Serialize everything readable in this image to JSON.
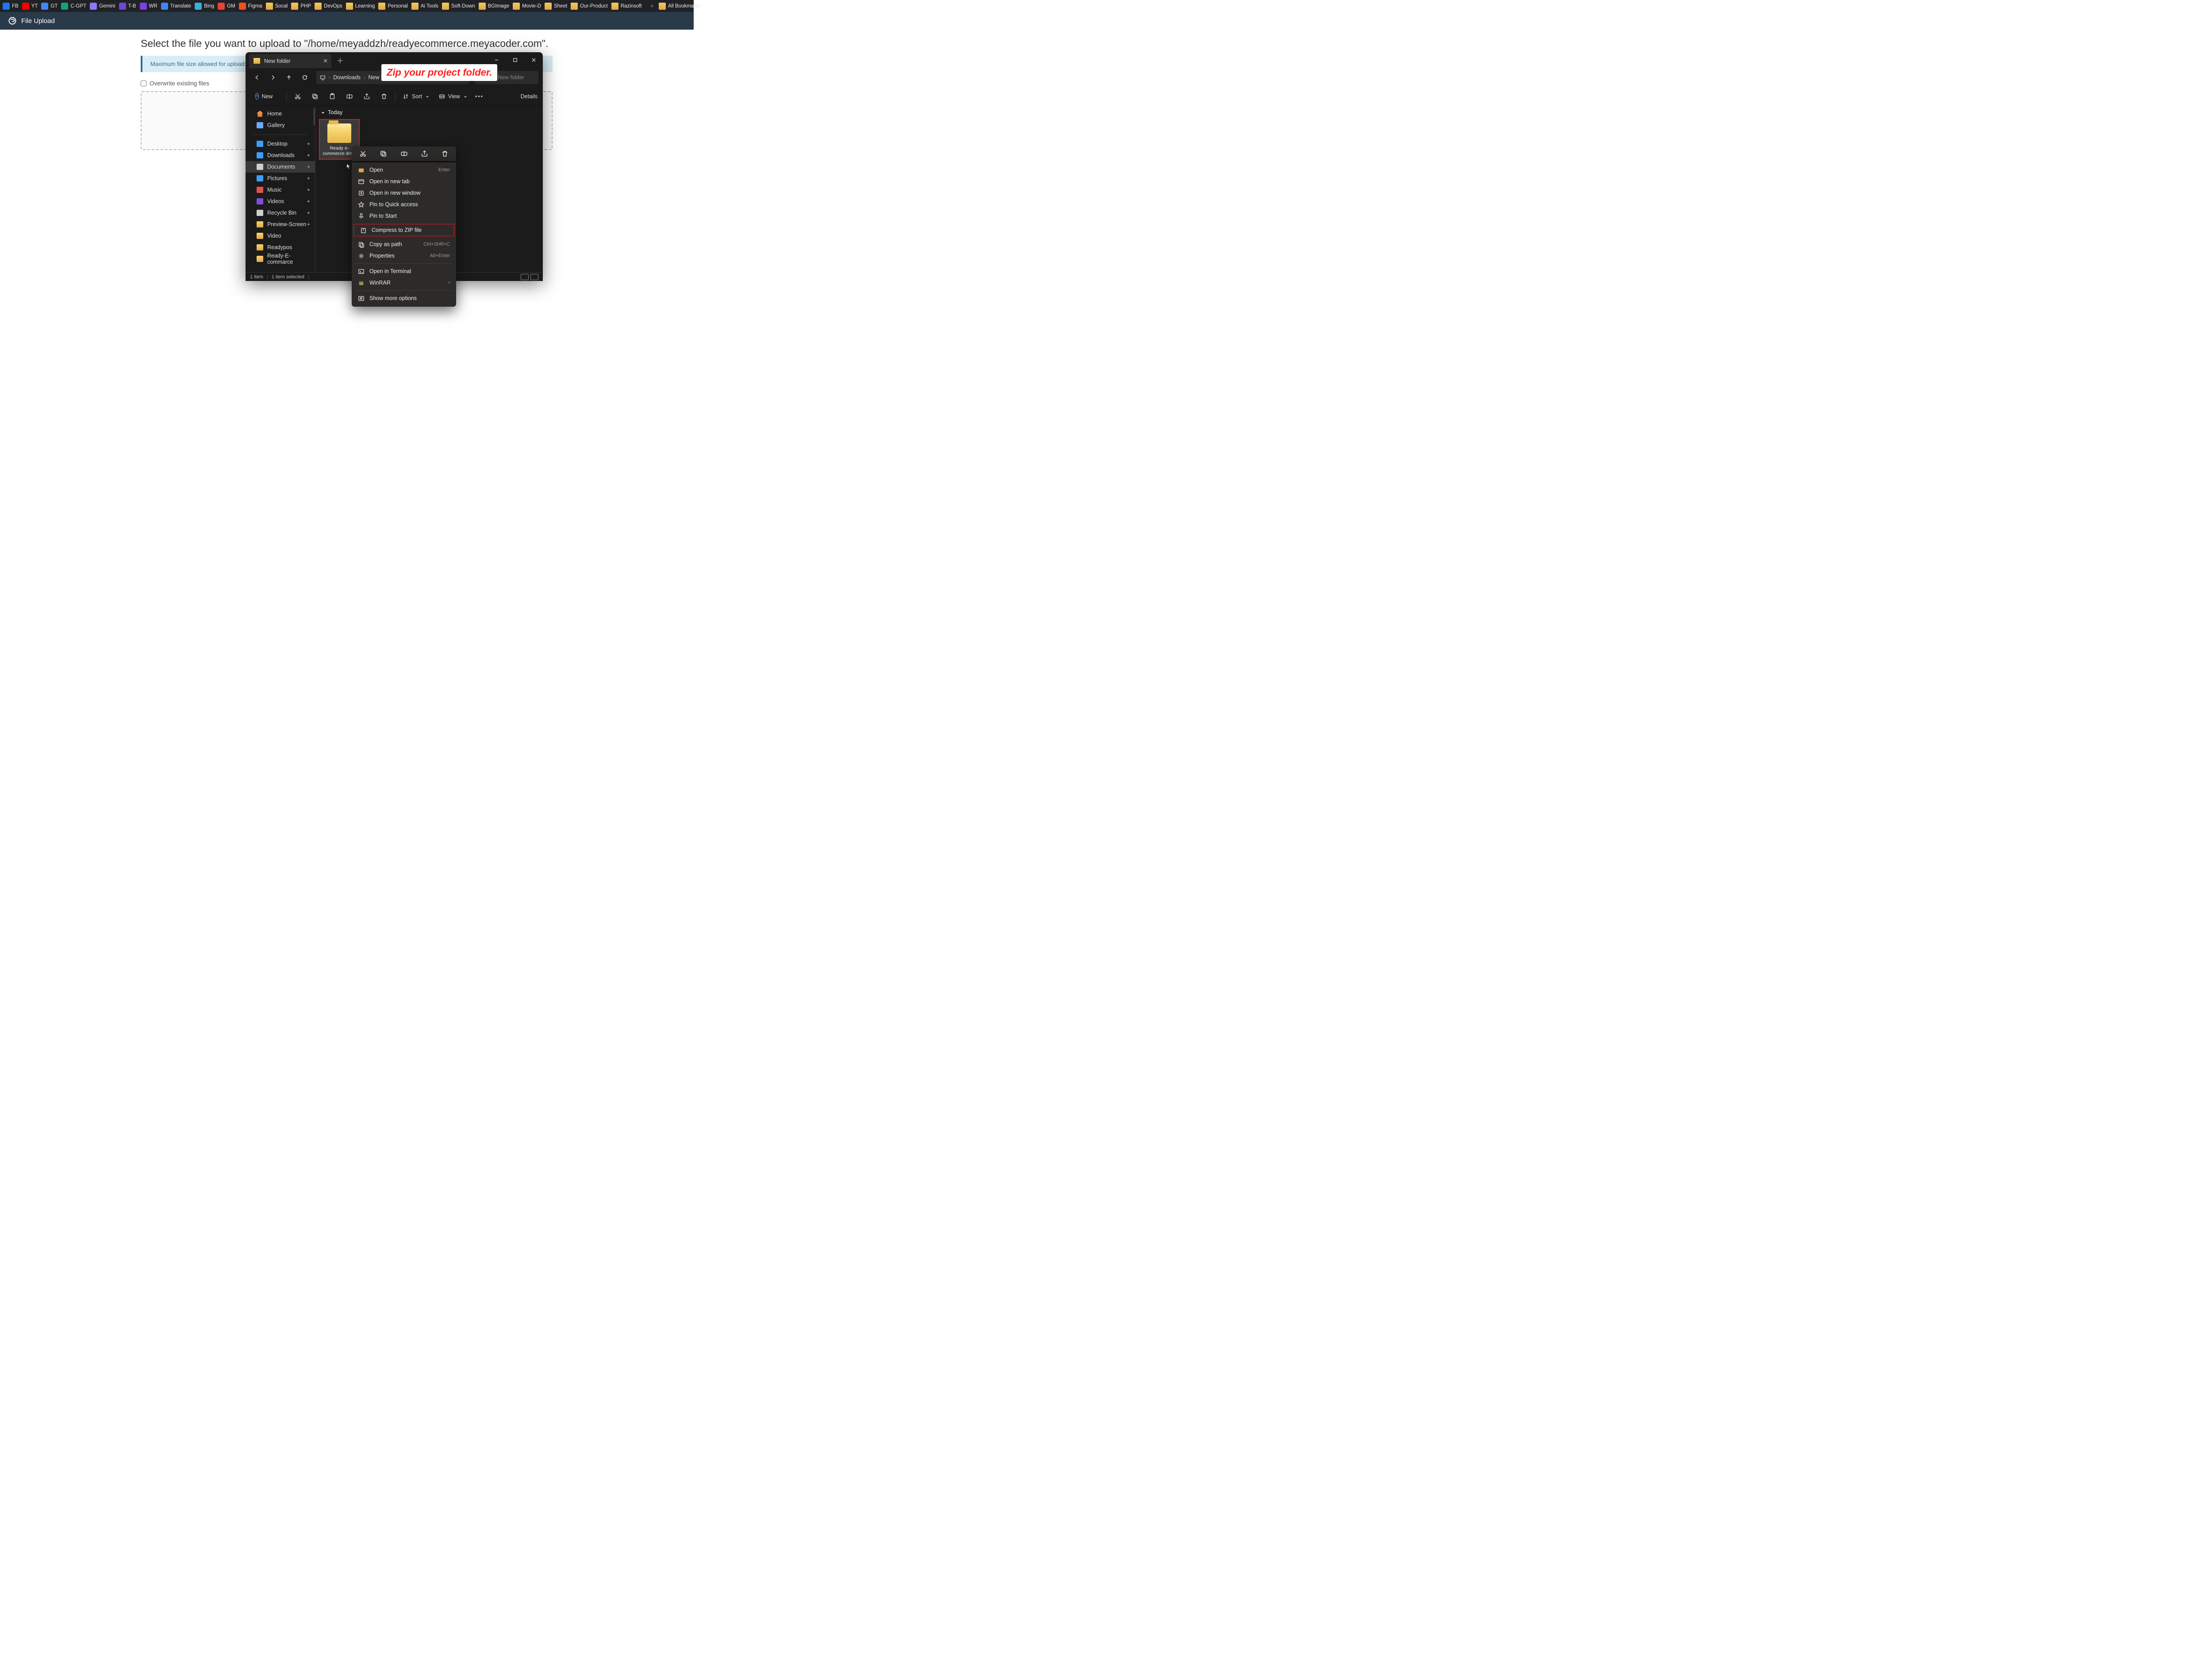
{
  "bookmarks": {
    "items": [
      {
        "label": "FB",
        "color": "#1877F2"
      },
      {
        "label": "YT",
        "color": "#FF0000"
      },
      {
        "label": "GT",
        "color": "#4285F4"
      },
      {
        "label": "C-GPT",
        "color": "#10A37F"
      },
      {
        "label": "Gemini",
        "color": "#8E75F9"
      },
      {
        "label": "T-B",
        "color": "#6E47D6"
      },
      {
        "label": "WR",
        "color": "#7B3FE4"
      },
      {
        "label": "Translate",
        "color": "#4285F4"
      },
      {
        "label": "Bing",
        "color": "#3AAEDC"
      },
      {
        "label": "GM",
        "color": "#EA4335"
      },
      {
        "label": "Figma",
        "color": "#F24E1E"
      }
    ],
    "folders": [
      "Socal",
      "PHP",
      "DevOps",
      "Learning",
      "Personal",
      "Ai Tools",
      "Soft-Down",
      "BGImage",
      "Movie-D",
      "Sheet",
      "Our-Product",
      "Razinsoft"
    ],
    "more": "»",
    "all": "All Bookmarks"
  },
  "cpanel": {
    "title": "File Upload"
  },
  "page": {
    "heading": "Select the file you want to upload to \"/home/meyaddzh/readyecommerce.meyacoder.com\".",
    "maxsize": "Maximum file size allowed for upload: ∞",
    "overwrite": "Overwrite existing files"
  },
  "explorer": {
    "tab": "New folder",
    "breadcrumb": [
      "Downloads",
      "New folder"
    ],
    "search": "Search New folder",
    "toolbar": {
      "new": "New",
      "sort": "Sort",
      "view": "View",
      "details": "Details"
    },
    "sidebar_top": [
      {
        "label": "Home",
        "type": "home"
      },
      {
        "label": "Gallery",
        "type": "gallery"
      }
    ],
    "sidebar": [
      {
        "label": "Desktop",
        "color": "#3aa0ff",
        "pin": true
      },
      {
        "label": "Downloads",
        "color": "#3aa0ff",
        "pin": true
      },
      {
        "label": "Documents",
        "color": "#cfcfcf",
        "pin": true,
        "sel": true
      },
      {
        "label": "Pictures",
        "color": "#3aa0ff",
        "pin": true
      },
      {
        "label": "Music",
        "color": "#e1524c",
        "pin": true
      },
      {
        "label": "Videos",
        "color": "#7b52d6",
        "pin": true
      },
      {
        "label": "Recycle Bin",
        "color": "#cfcfcf",
        "pin": true
      },
      {
        "label": "Preview-Screen",
        "color": "#e0a93f",
        "pin": true
      },
      {
        "label": "Video",
        "color": "#e0a93f",
        "pin": false
      },
      {
        "label": "Readypos",
        "color": "#e0a93f",
        "pin": false
      },
      {
        "label": "Ready-E-commarce",
        "color": "#e0a93f",
        "pin": false
      }
    ],
    "group": "Today",
    "folder_name": "Ready e-commerce dmin",
    "status": {
      "items": "1 item",
      "selected": "1 item selected"
    }
  },
  "callout": "Zip your project folder.",
  "context": {
    "items": [
      {
        "label": "Open",
        "shortcut": "Enter",
        "icon": "open"
      },
      {
        "label": "Open in new tab",
        "icon": "newtab"
      },
      {
        "label": "Open in new window",
        "icon": "newwin"
      },
      {
        "label": "Pin to Quick access",
        "icon": "pin"
      },
      {
        "label": "Pin to Start",
        "icon": "pin2"
      },
      {
        "label": "Compress to ZIP file",
        "icon": "zip",
        "hl": true
      },
      {
        "label": "Copy as path",
        "shortcut": "Ctrl+Shift+C",
        "icon": "copypath"
      },
      {
        "label": "Properties",
        "shortcut": "Alt+Enter",
        "icon": "props"
      },
      {
        "div": true
      },
      {
        "label": "Open in Terminal",
        "icon": "terminal"
      },
      {
        "label": "WinRAR",
        "icon": "winrar",
        "sub": true
      },
      {
        "div": true
      },
      {
        "label": "Show more options",
        "icon": "more"
      }
    ]
  }
}
